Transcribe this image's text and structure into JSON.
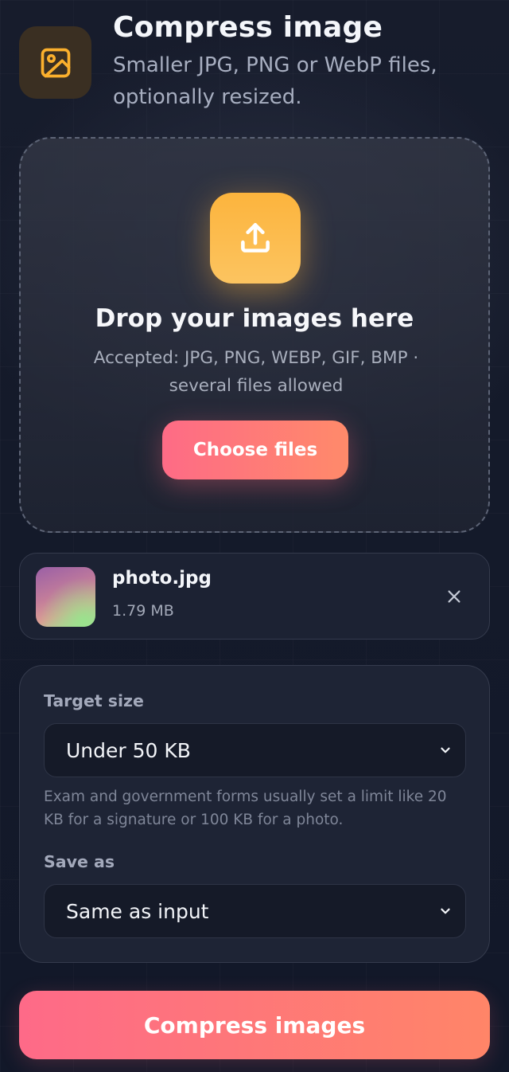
{
  "header": {
    "title": "Compress image",
    "subtitle": "Smaller JPG, PNG or WebP files, optionally resized.",
    "icon": "image-icon",
    "accent": "#fbb02d"
  },
  "dropzone": {
    "icon": "upload-icon",
    "title": "Drop your images here",
    "accepted": "Accepted: JPG, PNG, WEBP, GIF, BMP · several files allowed",
    "choose_label": "Choose files"
  },
  "files": [
    {
      "name": "photo.jpg",
      "size": "1.79 MB",
      "remove_icon": "close-icon"
    }
  ],
  "settings": {
    "target_size": {
      "label": "Target size",
      "value": "Under 50 KB",
      "help": "Exam and government forms usually set a limit like 20 KB for a signature or 100 KB for a photo."
    },
    "save_as": {
      "label": "Save as",
      "value": "Same as input"
    }
  },
  "actions": {
    "compress_label": "Compress images",
    "gradient_start": "#fe6a88",
    "gradient_end": "#ff8568"
  }
}
